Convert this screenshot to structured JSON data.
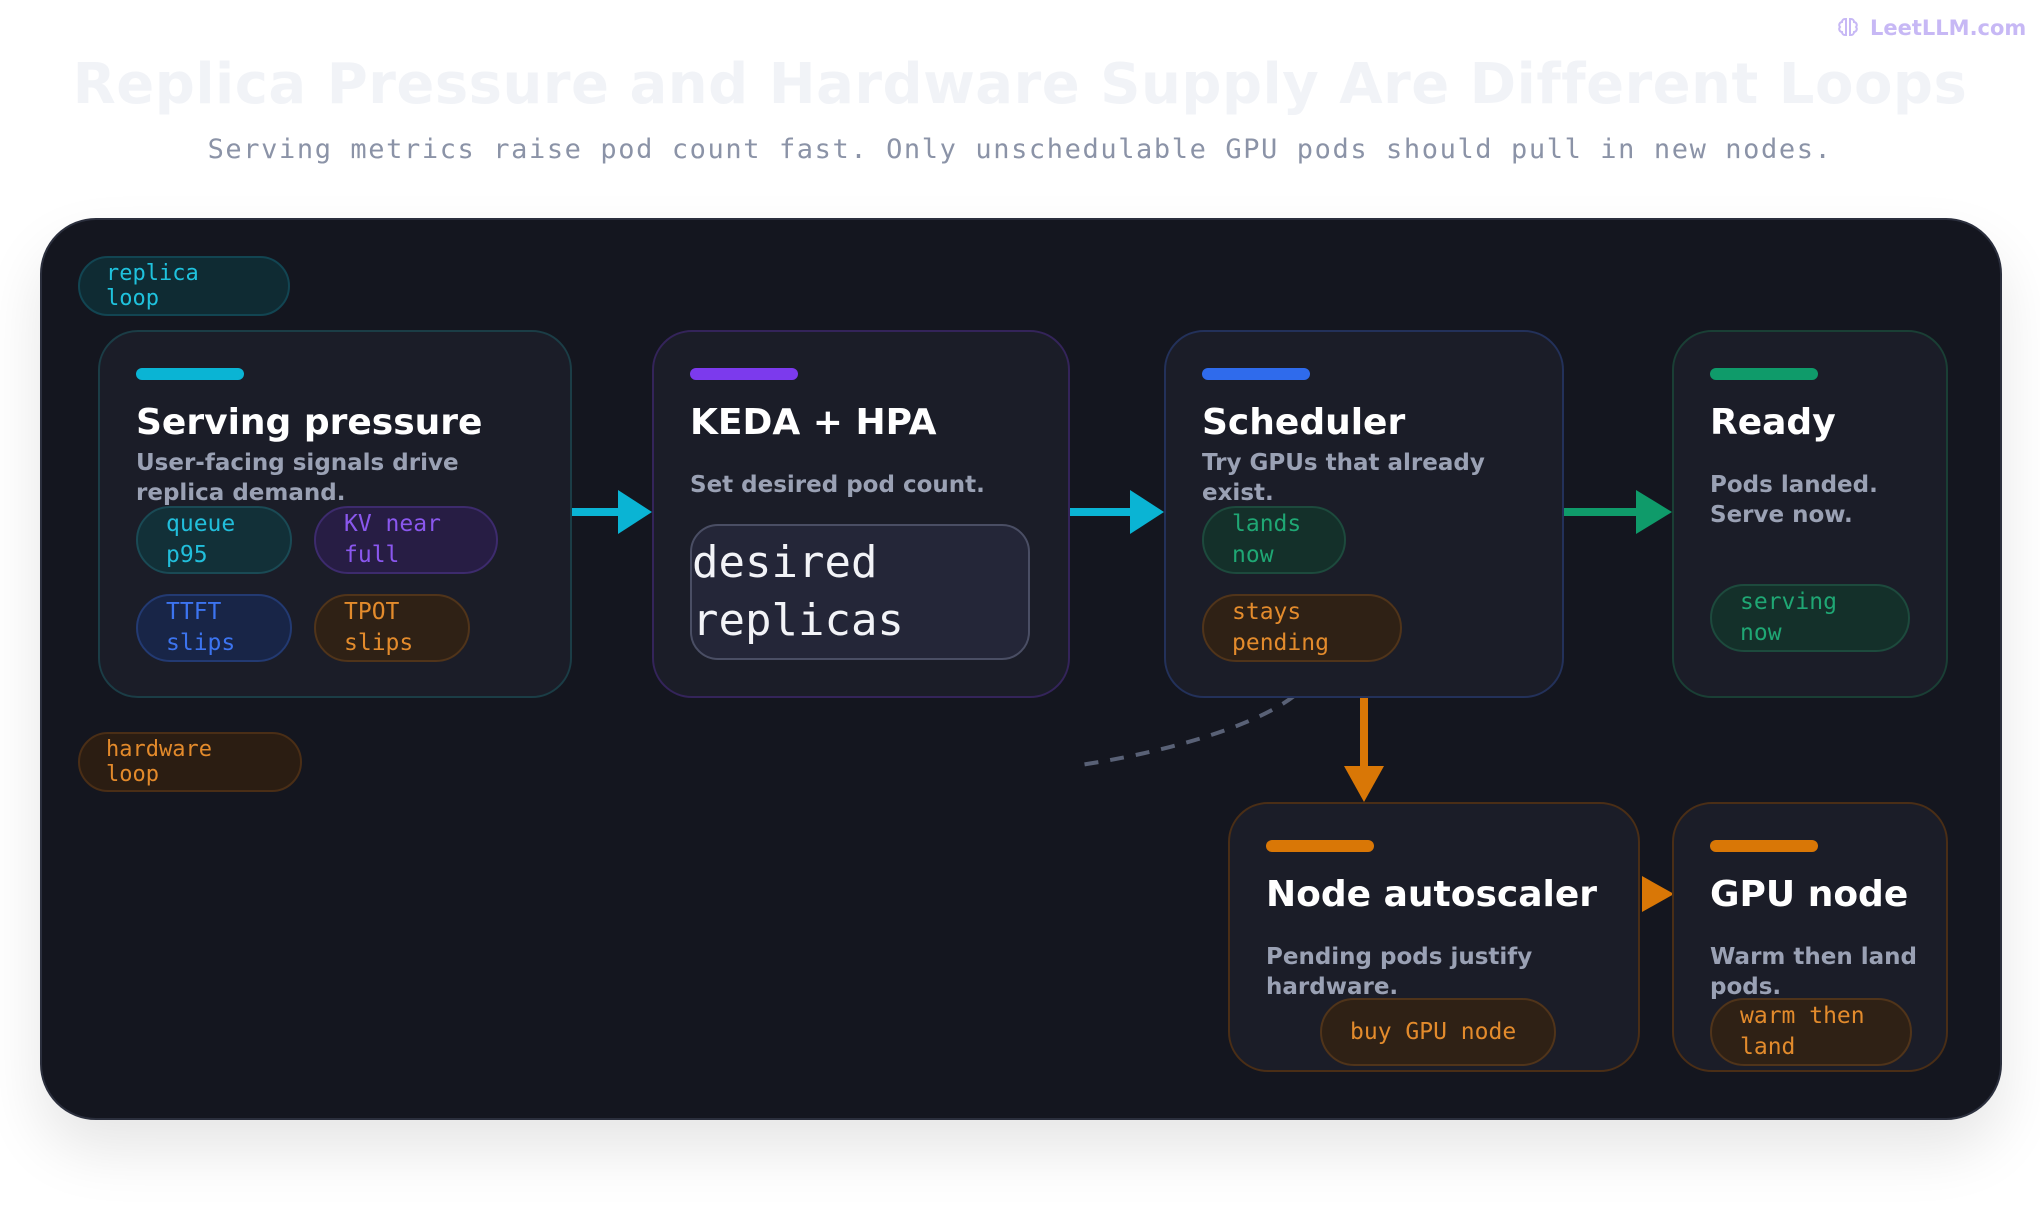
{
  "brand": {
    "name": "LeetLLM.com"
  },
  "header": {
    "title": "Replica Pressure and Hardware Supply Are Different Loops",
    "subtitle": "Serving metrics raise pod count fast. Only unschedulable GPU pods should pull in new nodes."
  },
  "loops": {
    "replica": "replica loop",
    "hardware": "hardware loop"
  },
  "cards": {
    "serving": {
      "title": "Serving pressure",
      "desc": "User-facing signals drive replica demand.",
      "chips": [
        "queue p95",
        "KV near full",
        "TTFT slips",
        "TPOT slips"
      ]
    },
    "keda": {
      "title": "KEDA + HPA",
      "desc": "Set desired pod count.",
      "box": "desired replicas"
    },
    "scheduler": {
      "title": "Scheduler",
      "desc": "Try GPUs that already exist.",
      "chips": [
        "lands now",
        "stays pending"
      ]
    },
    "ready": {
      "title": "Ready",
      "desc": "Pods landed. Serve now.",
      "chips": [
        "serving now"
      ]
    },
    "node_autoscaler": {
      "title": "Node autoscaler",
      "desc": "Pending pods justify hardware.",
      "chips": [
        "buy GPU node"
      ]
    },
    "gpu_node": {
      "title": "GPU node",
      "desc": "Warm then land pods.",
      "chips": [
        "warm then land"
      ]
    }
  },
  "colors": {
    "cyan": "#0ab4d4",
    "purple": "#7c3aed",
    "blue": "#2f6bec",
    "green": "#0f9b6a",
    "orange": "#d97706",
    "panel": "#14161f"
  }
}
